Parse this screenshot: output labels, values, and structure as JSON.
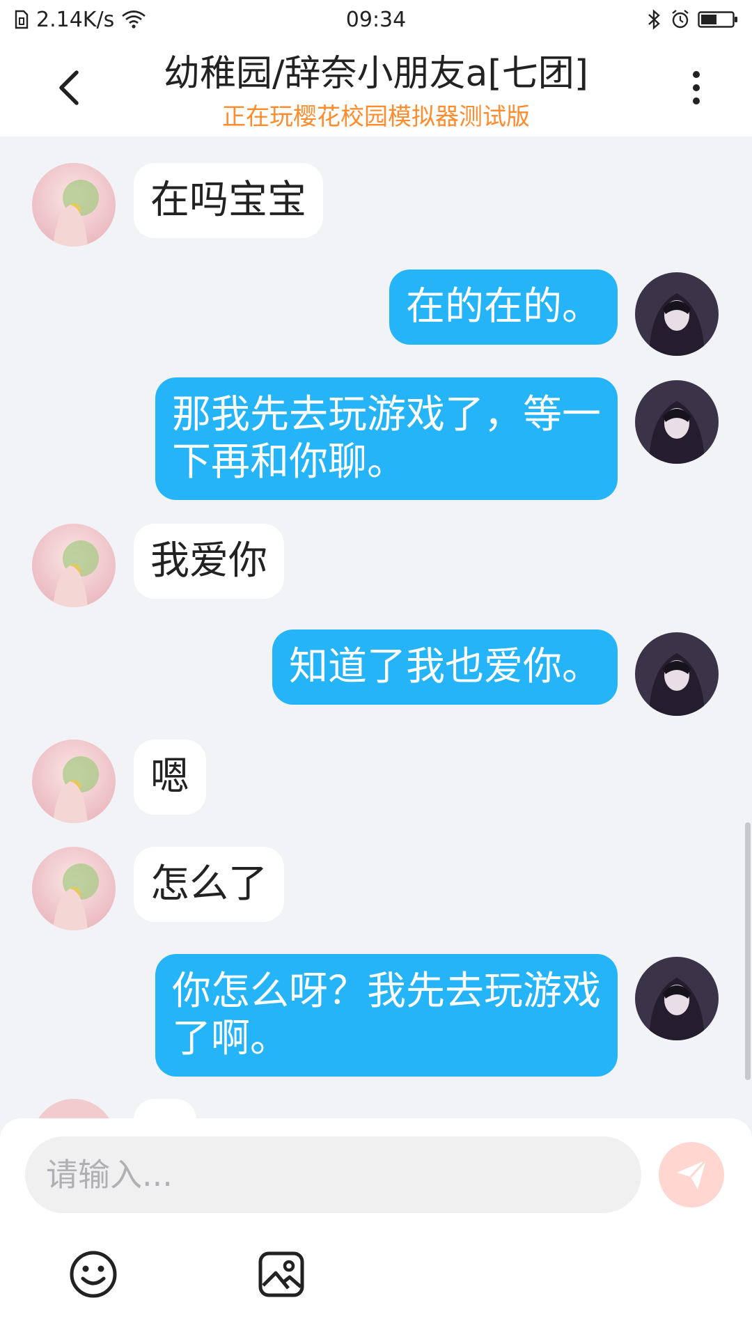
{
  "status_bar": {
    "network_speed": "2.14K/s",
    "time": "09:34"
  },
  "header": {
    "title": "幼稚园/辞奈小朋友a[七团]",
    "subtitle": "正在玩樱花校园模拟器测试版"
  },
  "messages": [
    {
      "side": "in",
      "text_lines": [
        "在吗宝宝"
      ]
    },
    {
      "side": "out",
      "text_lines": [
        "在的在的。"
      ]
    },
    {
      "side": "out",
      "text_lines": [
        "那我先去玩游戏了，等一",
        "下再和你聊。"
      ]
    },
    {
      "side": "in",
      "text_lines": [
        "我爱你"
      ]
    },
    {
      "side": "out",
      "text_lines": [
        "知道了我也爱你。"
      ]
    },
    {
      "side": "in",
      "text_lines": [
        "嗯"
      ]
    },
    {
      "side": "in",
      "text_lines": [
        "怎么了"
      ]
    },
    {
      "side": "out",
      "text_lines": [
        "你怎么呀？我先去玩游戏",
        "了啊。"
      ]
    }
  ],
  "input": {
    "placeholder": "请输入..."
  },
  "icons": {
    "back": "chevron-left-icon",
    "more": "more-vertical-icon",
    "send": "send-icon",
    "emoji": "emoji-icon",
    "image": "image-icon"
  },
  "colors": {
    "outgoing_bubble": "#24b4f7",
    "incoming_bubble": "#ffffff",
    "subtitle": "#ff8c2e",
    "background": "#f2f3f7",
    "send_button": "#ffd6d0"
  }
}
